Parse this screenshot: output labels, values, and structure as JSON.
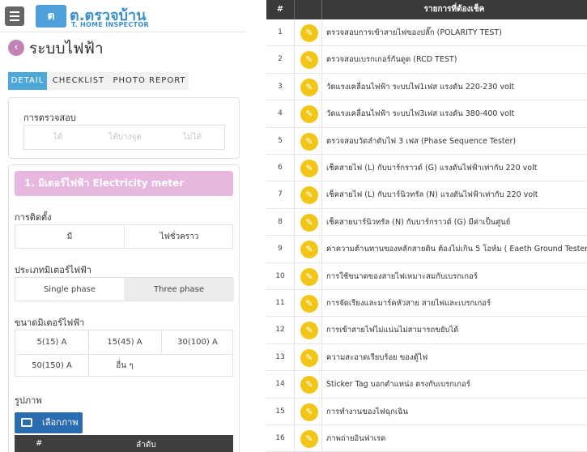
{
  "app": {
    "logo_mark": "ต",
    "logo_name": "ต.ตรวจบ้าน",
    "logo_sub": "T. HOME INSPECTOR"
  },
  "page": {
    "title": "ระบบไฟฟ้า"
  },
  "tabs": [
    "DETAIL",
    "CHECKLIST",
    "PHOTO REPORT"
  ],
  "inspection": {
    "label": "การตรวจสอบ",
    "options": [
      "ได้",
      "ได้บางจุด",
      "ไม่ได้"
    ]
  },
  "section": {
    "title": "1. มิเตอร์ไฟฟ้า Electricity meter"
  },
  "installation": {
    "label": "การติดตั้ง",
    "options": [
      "มี",
      "ไฟชั่วคราว"
    ]
  },
  "meter_type": {
    "label": "ประเภทมิเตอร์ไฟฟ้า",
    "options": [
      "Single phase",
      "Three phase"
    ],
    "selected": "Three phase"
  },
  "meter_size": {
    "label": "ขนาดมิเตอร์ไฟฟ้า",
    "options": [
      "5(15) A",
      "15(45) A",
      "30(100) A",
      "50(150) A",
      "อื่น ๆ"
    ]
  },
  "photos": {
    "label": "รูปภาพ",
    "choose_label": "เลือกภาพ",
    "table_headers": [
      "#",
      "ลำดับ"
    ]
  },
  "checklist": {
    "headers": {
      "num": "#",
      "items": "รายการที่ต้องเช็ค"
    },
    "rows": [
      {
        "n": "1",
        "text": "ตรวจสอบการเข้าสายไฟของปลั๊ก (POLARITY TEST)"
      },
      {
        "n": "2",
        "text": "ตรวจสอบเบรกเกอร์กันดูด (RCD TEST)"
      },
      {
        "n": "3",
        "text": "วัดแรงเคลื่อนไฟฟ้า ระบบไฟ1เฟส แรงดัน 220-230 volt"
      },
      {
        "n": "4",
        "text": "วัดแรงเคลื่อนไฟฟ้า ระบบไฟ3เฟส แรงดัน 380-400 volt"
      },
      {
        "n": "5",
        "text": "ตรวจสอบวัดลำดับไฟ 3 เฟส (Phase Sequence Tester)"
      },
      {
        "n": "6",
        "text": "เช็คสายไฟ (L) กับบาร์กราวด์ (G) แรงดันไฟฟ้าเท่ากับ 220 volt"
      },
      {
        "n": "7",
        "text": "เช็คสายไฟ (L) กับบาร์นิวทรัล (N) แรงดันไฟฟ้าเท่ากับ 220 volt"
      },
      {
        "n": "8",
        "text": "เช็คสายบาร์นิวทรัล (N) กับบาร์กราวด์ (G) มีค่าเป็นศูนย์"
      },
      {
        "n": "9",
        "text": "ค่าความต้านทานของหลักสายดิน ต้องไม่เกิน 5 โอห์ม ( Eaeth Ground Tester )"
      },
      {
        "n": "10",
        "text": "การใช้ขนาดของสายไฟเหมาะสมกับเบรกเกอร์"
      },
      {
        "n": "11",
        "text": "การจัดเรียงและมาร์คหัวสาย สายไฟและเบรกเกอร์"
      },
      {
        "n": "12",
        "text": "การเข้าสายไฟไม่แน่นไม่สามารถขยับได้"
      },
      {
        "n": "13",
        "text": "ความสะอาดเรียบร้อย ของตู้ไฟ"
      },
      {
        "n": "14",
        "text": "Sticker Tag บอกตำแหน่ง ตรงกับเบรกเกอร์"
      },
      {
        "n": "15",
        "text": "การทำงานของไฟฉุกเฉิน"
      },
      {
        "n": "16",
        "text": "ภาพถ่ายอินฟาเรด"
      }
    ]
  },
  "colors": {
    "accent_blue": "#4fa9d8",
    "pink": "#e8b7df",
    "edit_yellow": "#f2c619",
    "header_dark": "#3a3a3a"
  },
  "icons": {
    "menu": "hamburger-icon",
    "back": "chevron-left-icon",
    "edit": "edit-icon",
    "image": "image-icon"
  }
}
